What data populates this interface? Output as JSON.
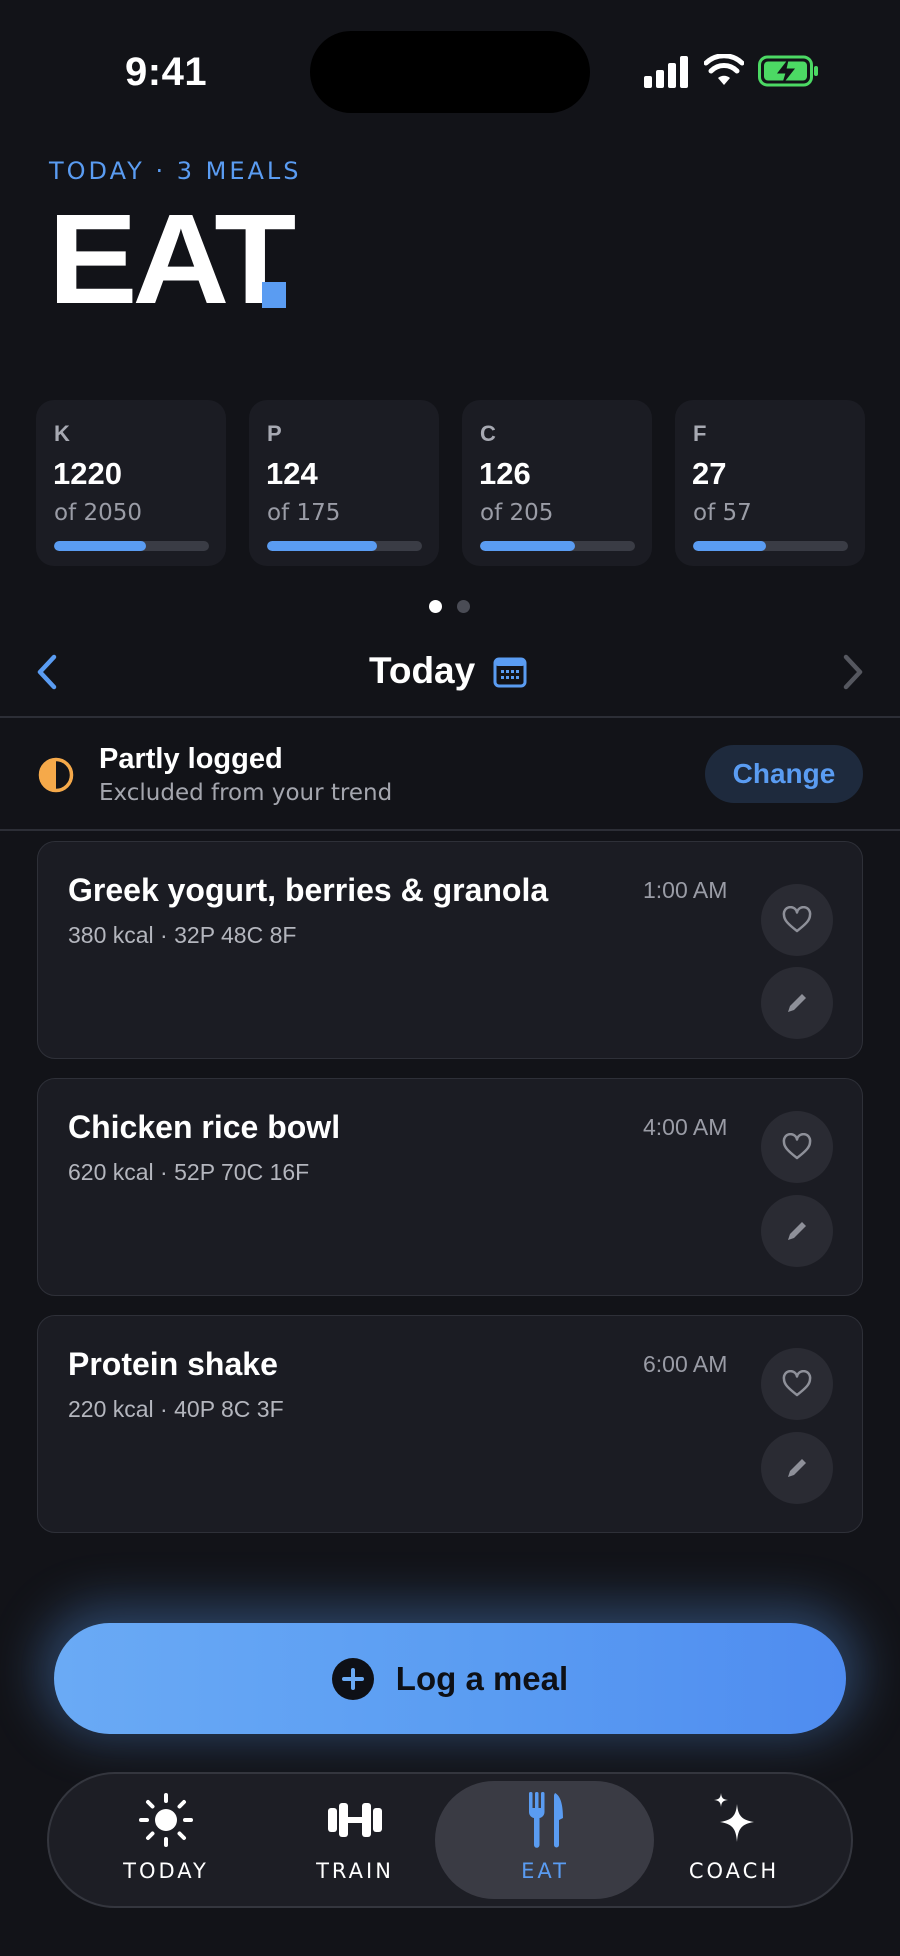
{
  "status_bar": {
    "time": "9:41"
  },
  "header": {
    "eyebrow": "TODAY · 3 MEALS",
    "title": "EAT",
    "accent_color": "#5a9cf2"
  },
  "macros": [
    {
      "letter": "K",
      "value": "1220",
      "goal": "of 2050",
      "progress": 0.595
    },
    {
      "letter": "P",
      "value": "124",
      "goal": "of 175",
      "progress": 0.709
    },
    {
      "letter": "C",
      "value": "126",
      "goal": "of 205",
      "progress": 0.615
    },
    {
      "letter": "F",
      "value": "27",
      "goal": "of 57",
      "progress": 0.474
    }
  ],
  "pager": {
    "pages": 2,
    "active": 1
  },
  "date_nav": {
    "label": "Today"
  },
  "log_status": {
    "title": "Partly logged",
    "subtitle": "Excluded from your trend",
    "change_label": "Change",
    "icon": "half-circle-icon",
    "icon_color": "#f5a94a"
  },
  "meals": [
    {
      "name": "Greek yogurt, berries & granola",
      "macros": "380 kcal · 32P 48C 8F",
      "time": "1:00 AM"
    },
    {
      "name": "Chicken rice bowl",
      "macros": "620 kcal · 52P 70C 16F",
      "time": "4:00 AM"
    },
    {
      "name": "Protein shake",
      "macros": "220 kcal · 40P 8C 3F",
      "time": "6:00 AM"
    }
  ],
  "log_button": {
    "label": "Log a meal"
  },
  "tabs": [
    {
      "label": "TODAY",
      "icon": "sun-icon",
      "active": false
    },
    {
      "label": "TRAIN",
      "icon": "dumbbell-icon",
      "active": false
    },
    {
      "label": "EAT",
      "icon": "fork-knife-icon",
      "active": true
    },
    {
      "label": "COACH",
      "icon": "sparkle-icon",
      "active": false
    }
  ]
}
